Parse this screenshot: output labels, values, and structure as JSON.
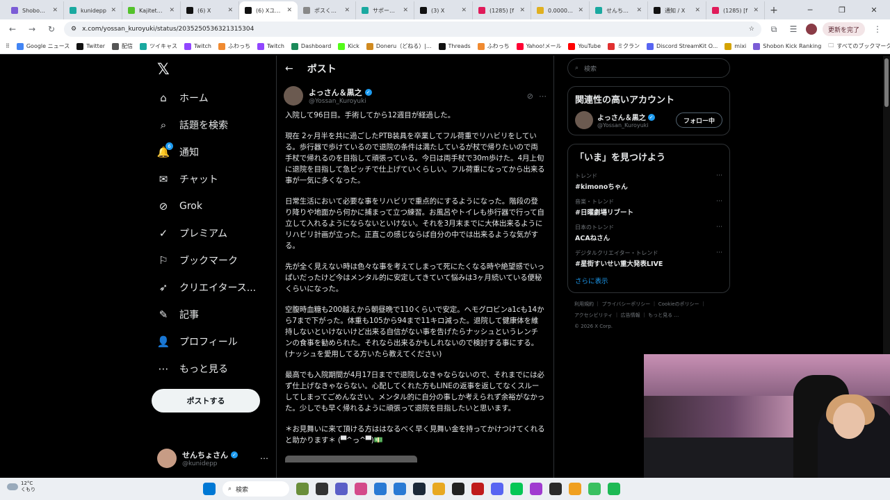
{
  "browser": {
    "tabs": [
      {
        "label": "Shobon K",
        "color": "#7b5cd6",
        "active": false
      },
      {
        "label": "kunidepp",
        "color": "#1aa9a0",
        "active": false
      },
      {
        "label": "KajitetuEy",
        "color": "#53c22b",
        "active": false
      },
      {
        "label": "(6) X",
        "color": "#111111",
        "active": false
      },
      {
        "label": "(6) Xユーザ",
        "color": "#111111",
        "active": true
      },
      {
        "label": "ポスくんv8",
        "color": "#888888",
        "active": false
      },
      {
        "label": "サポーター",
        "color": "#1aa9a0",
        "active": false
      },
      {
        "label": "(3) X",
        "color": "#111111",
        "active": false
      },
      {
        "label": "(1285) [f",
        "color": "#e01b5a",
        "active": false
      },
      {
        "label": "0.000016",
        "color": "#e0b020",
        "active": false
      },
      {
        "label": "せんちょさん",
        "color": "#1aa9a0",
        "active": false
      },
      {
        "label": "通知 / X",
        "color": "#111111",
        "active": false
      },
      {
        "label": "(1285) [f",
        "color": "#e01b5a",
        "active": false
      }
    ],
    "url": "x.com/yossan_kuroyuki/status/2035250536321315304",
    "pause_label": "更新を完了",
    "bookmarks": [
      {
        "label": "Google ニュース",
        "color": "#4285f4"
      },
      {
        "label": "Twitter",
        "color": "#111111"
      },
      {
        "label": "配信",
        "color": "#555555"
      },
      {
        "label": "ツイキャス",
        "color": "#1aa9a0"
      },
      {
        "label": "Twitch",
        "color": "#9146ff"
      },
      {
        "label": "ふわっち",
        "color": "#f08a30"
      },
      {
        "label": "Twitch",
        "color": "#9146ff"
      },
      {
        "label": "Dashboard",
        "color": "#1b8a5a"
      },
      {
        "label": "Kick",
        "color": "#53fc18"
      },
      {
        "label": "Doneru（どねる）|...",
        "color": "#d08a20"
      },
      {
        "label": "Threads",
        "color": "#111111"
      },
      {
        "label": "ふわっち",
        "color": "#f08a30"
      },
      {
        "label": "Yahoo!メール",
        "color": "#ff0033"
      },
      {
        "label": "YouTube",
        "color": "#ff0000"
      },
      {
        "label": "ミクラン",
        "color": "#e03030"
      },
      {
        "label": "Discord StreamKit O...",
        "color": "#5865f2"
      },
      {
        "label": "mixi",
        "color": "#d4a300"
      },
      {
        "label": "Shobon Kick Ranking",
        "color": "#7b5cd6"
      }
    ],
    "all_bookmarks_label": "すべてのブックマーク"
  },
  "nav": {
    "items": [
      {
        "name": "home",
        "icon": "home-icon",
        "glyph": "⌂",
        "label": "ホーム"
      },
      {
        "name": "explore",
        "icon": "search-icon",
        "glyph": "⌕",
        "label": "話題を検索"
      },
      {
        "name": "notifications",
        "icon": "bell-icon",
        "glyph": "🔔",
        "label": "通知",
        "badge": "6"
      },
      {
        "name": "chat",
        "icon": "mail-icon",
        "glyph": "✉",
        "label": "チャット"
      },
      {
        "name": "grok",
        "icon": "grok-icon",
        "glyph": "⊘",
        "label": "Grok"
      },
      {
        "name": "premium",
        "icon": "premium-icon",
        "glyph": "✓",
        "label": "プレミアム"
      },
      {
        "name": "bookmarks",
        "icon": "bookmark-icon",
        "glyph": "⚐",
        "label": "ブックマーク"
      },
      {
        "name": "creator",
        "icon": "rocket-icon",
        "glyph": "➶",
        "label": "クリエイタース..."
      },
      {
        "name": "articles",
        "icon": "article-icon",
        "glyph": "✎",
        "label": "記事"
      },
      {
        "name": "profile",
        "icon": "person-icon",
        "glyph": "👤",
        "label": "プロフィール"
      },
      {
        "name": "more",
        "icon": "more-icon",
        "glyph": "⋯",
        "label": "もっと見る"
      }
    ],
    "post_button": "ポストする",
    "me": {
      "display_name": "せんちょさん",
      "handle": "@kunidepp"
    }
  },
  "post": {
    "header_title": "ポスト",
    "author_name": "よっさん＆黒之",
    "author_handle": "@Yossan_Kuroyuki",
    "paragraphs": [
      "入院して96日目。手術してから12週目が経過した。",
      "現在 2ヶ月半を共に過ごしたPTB装具を卒業してフル荷重でリハビリをしている。歩行器で歩けているので退院の条件は満たしているが杖で帰りたいので両手杖で帰れるのを目指して頑張っている。今日は両手杖で30m歩けた。4月上旬に退院を目指して急ピッチで仕上げていくらしい。フル荷重になってから出来る事が一気に多くなった。",
      "日常生活において必要な事をリハビリで重点的にするようになった。階段の登り降りや地面から何かに捕まって立つ練習。お風呂やトイレも歩行器で行って自立して入れるようにならないといけない。それを3月末までに大体出来るようにリハビリ計画が立った。正直この感じならば自分の中では出来るような気がする。",
      "先が全く見えない時は色々な事を考えてしまって死にたくなる時や絶望感でいっぱいだったけど今はメンタル的に安定してきていて悩みは3ヶ月続いている便秘くらいになった。",
      "空腹時血糖も200越えから朝昼晩で110くらいで安定。ヘモグロビンa1cも14から7まで下がった。体重も105から94まで11キロ減った。退院して健康体を維持しないといけないけど出来る自信がない事を告げたらナッシュというレンチンの食事を勧められた。それなら出来るかもしれないので検討する事にする。(ナッシュを愛用してる方いたら教えてください)",
      "最高でも入院期間が4月17日までで退院しなきゃならないので、それまでには必ず仕上げなきゃならない。心配してくれた方もLINEの返事を返してなくスルーしてしまってごめんなさい。メンタル的に自分の事しか考えられず余裕がなかった。少しでも早く帰れるように頑張って退院を目指したいと思います。",
      "＊お見舞いに来て頂ける方ははなるべく早く見舞い金を持ってかけつけてくれると助かります＊ (▀^っ^▀)💵"
    ]
  },
  "sidebar": {
    "search_placeholder": "検索",
    "related_title": "関連性の高いアカウント",
    "related": {
      "name": "よっさん＆黒之",
      "handle": "@Yossan_Kuroyuki",
      "button": "フォロー中"
    },
    "trends_title": "「いま」を見つけよう",
    "trends": [
      {
        "meta": "トレンド",
        "name": "#kimonoちゃん"
      },
      {
        "meta": "音楽・トレンド",
        "name": "#日曜劇場リブート"
      },
      {
        "meta": "日本のトレンド",
        "name": "ACAねさん"
      },
      {
        "meta": "デジタルクリエイター・トレンド",
        "name": "#星街すいせい重大発表LIVE"
      }
    ],
    "show_more": "さらに表示",
    "footer_line1": "利用規約 ｜ プライバシーポリシー ｜ Cookieのポリシー ｜",
    "footer_line2": "アクセシビリティ ｜ 広告情報 ｜ もっと見る …",
    "footer_line3": "© 2026 X Corp."
  },
  "taskbar": {
    "temp": "12°C",
    "weather": "くもり",
    "search_label": "検索",
    "app_colors": [
      "#6a8e3a",
      "#333333",
      "#5b5fc7",
      "#d44a8a",
      "#2a7ad4",
      "#2a7ad4",
      "#1b2838",
      "#e8a820",
      "#222222",
      "#c01c1c",
      "#5865f2",
      "#06c755",
      "#a03ad0",
      "#2a2a2a",
      "#f0a020",
      "#3ac060",
      "#1db954"
    ]
  }
}
